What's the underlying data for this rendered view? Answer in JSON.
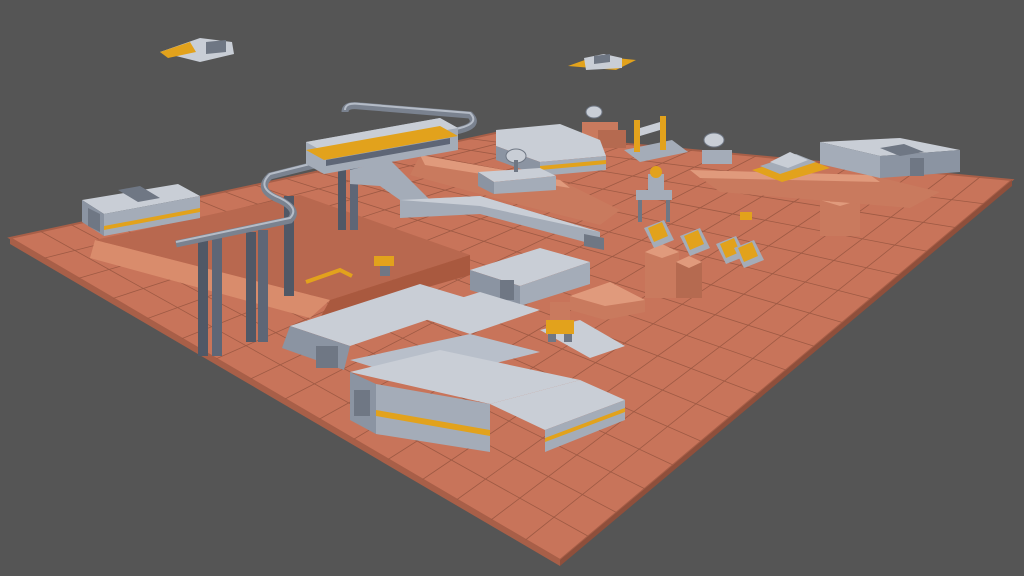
{
  "viewport": {
    "background": "#555555"
  },
  "palette": {
    "ground": "#c8745a",
    "ground_edge": "#a85f48",
    "grid_line": "#9e5a44",
    "rock_light": "#e09a7c",
    "rock_mid": "#c97a5e",
    "rock_dark": "#9a5540",
    "metal_light": "#c9ced6",
    "metal_mid": "#a4acb8",
    "metal_dark": "#6f7784",
    "accent": "#e2a21c",
    "accent_dark": "#b37a0c",
    "pillar": "#505866"
  },
  "scene": {
    "ground_cols": 16,
    "ground_rows": 16,
    "structures": [
      "main-base-complex",
      "hangar-west",
      "bunker-center",
      "monorail-track",
      "monorail-train",
      "pipeline",
      "command-dome",
      "hangar-east",
      "solar-array",
      "crane-gantry",
      "satellite-dishes",
      "hover-ship-1",
      "hover-ship-2",
      "mech-robot",
      "rover-1",
      "rock-formations",
      "landing-pad"
    ]
  }
}
